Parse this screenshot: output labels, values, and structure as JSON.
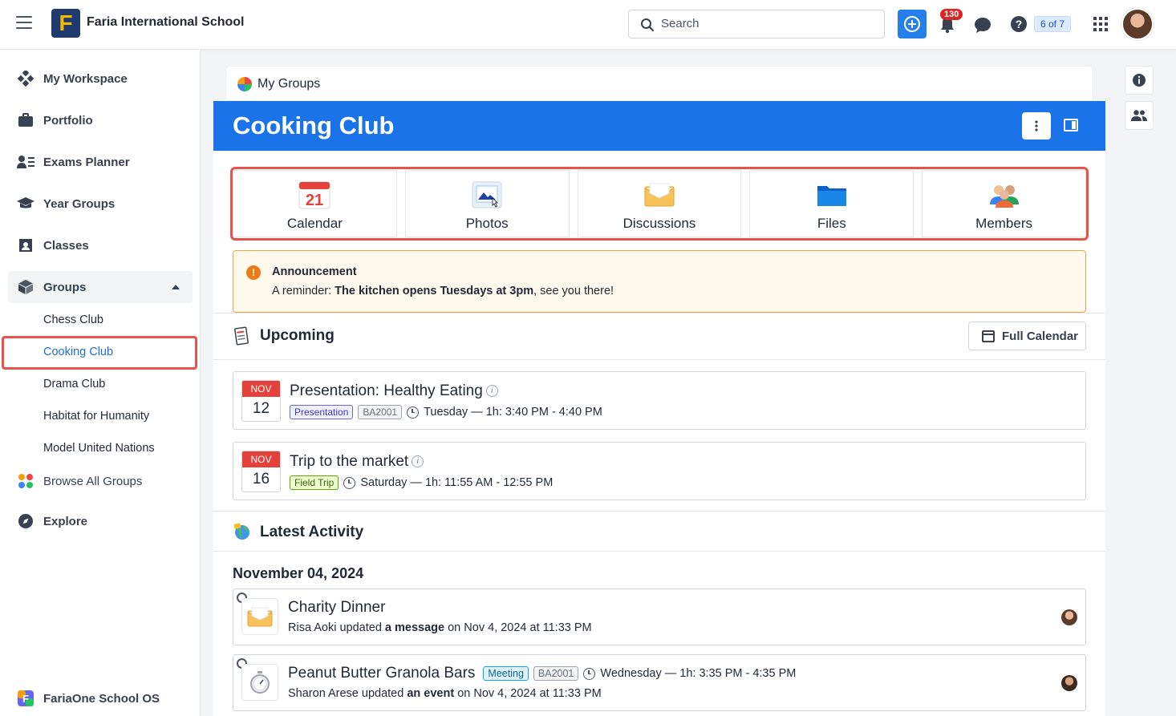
{
  "topbar": {
    "school_name": "Faria International School",
    "logo_letter": "F",
    "search_placeholder": "Search",
    "notifications_count": "130",
    "pager": "6 of 7"
  },
  "sidebar": {
    "items": [
      {
        "label": "My Workspace",
        "icon": "workspace-icon"
      },
      {
        "label": "Portfolio",
        "icon": "briefcase-icon"
      },
      {
        "label": "Exams Planner",
        "icon": "exams-icon"
      },
      {
        "label": "Year Groups",
        "icon": "graduation-cap-icon"
      },
      {
        "label": "Classes",
        "icon": "classes-icon"
      },
      {
        "label": "Groups",
        "icon": "cube-icon"
      },
      {
        "label": "Browse All Groups",
        "icon": "dots-icon"
      },
      {
        "label": "Explore",
        "icon": "compass-icon"
      }
    ],
    "groups": [
      "Chess Club",
      "Cooking Club",
      "Drama Club",
      "Habitat for Humanity",
      "Model United Nations"
    ],
    "footer_label": "FariaOne School OS"
  },
  "breadcrumb": "My Groups",
  "header": {
    "title": "Cooking Club"
  },
  "tiles": [
    {
      "label": "Calendar",
      "icon": "calendar-icon",
      "day": "21"
    },
    {
      "label": "Photos",
      "icon": "photos-icon"
    },
    {
      "label": "Discussions",
      "icon": "envelope-icon"
    },
    {
      "label": "Files",
      "icon": "folder-icon"
    },
    {
      "label": "Members",
      "icon": "members-icon"
    }
  ],
  "announcement": {
    "title": "Announcement",
    "prefix": "A reminder: ",
    "bold": "The kitchen opens Tuesdays at 3pm",
    "suffix": ", see you there!"
  },
  "upcoming": {
    "title": "Upcoming",
    "full_calendar": "Full Calendar",
    "events": [
      {
        "month": "NOV",
        "day": "12",
        "title": "Presentation: Healthy Eating",
        "tag": "Presentation",
        "code": "BA2001",
        "time": "Tuesday — 1h: 3:40 PM - 4:40 PM"
      },
      {
        "month": "NOV",
        "day": "16",
        "title": "Trip to the market",
        "tag": "Field Trip",
        "code": "",
        "time": "Saturday — 1h: 11:55 AM - 12:55 PM"
      }
    ]
  },
  "activity": {
    "title": "Latest Activity",
    "date": "November 04, 2024",
    "items": [
      {
        "title": "Charity Dinner",
        "user": "Risa Aoki updated ",
        "action": "a message",
        "when": " on Nov 4, 2024 at 11:33 PM"
      },
      {
        "title": "Peanut Butter Granola Bars",
        "tag": "Meeting",
        "code": "BA2001",
        "time": "Wednesday — 1h: 3:35 PM - 4:35 PM",
        "user": "Sharon Arese updated ",
        "action": "an event",
        "when": " on Nov 4, 2024 at 11:33 PM"
      }
    ]
  },
  "colors": {
    "brand_blue": "#1a73e8",
    "highlight": "#e5534b",
    "event_red": "#e5413c"
  }
}
